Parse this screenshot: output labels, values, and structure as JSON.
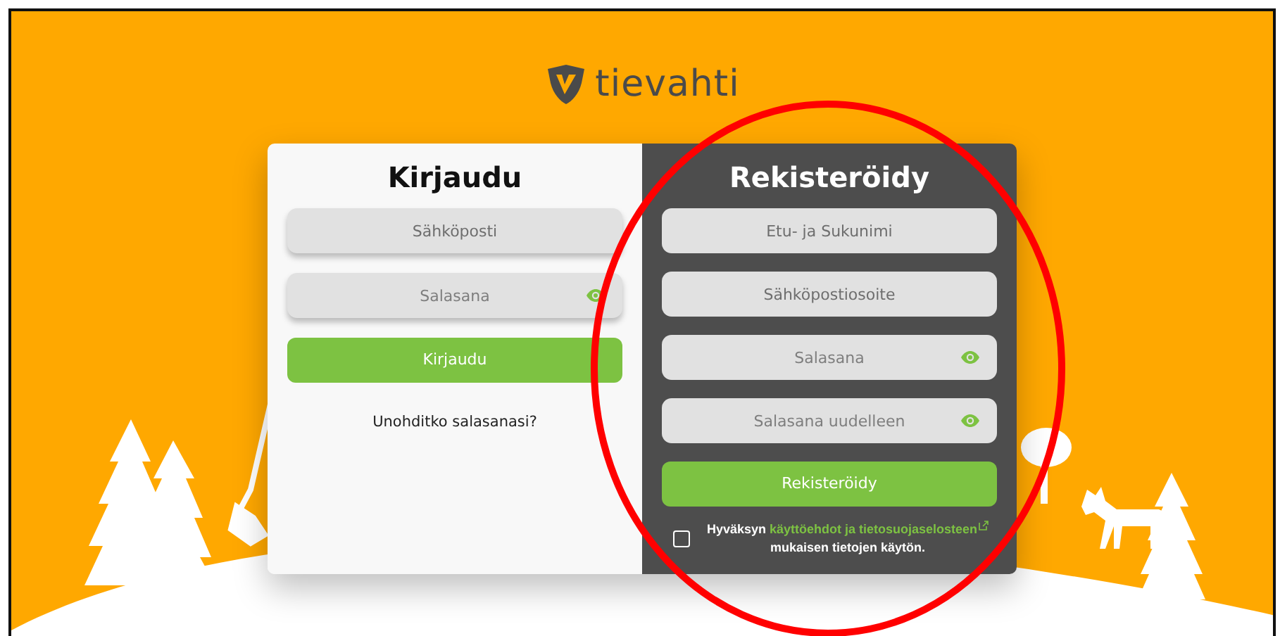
{
  "logo": {
    "text": "tievahti"
  },
  "login": {
    "title": "Kirjaudu",
    "fields": [
      {
        "placeholder": "Sähköposti",
        "kind": "text"
      },
      {
        "placeholder": "Salasana",
        "kind": "password"
      }
    ],
    "button": "Kirjaudu",
    "forgot_link": "Unohditko salasanasi?"
  },
  "register": {
    "title": "Rekisteröidy",
    "fields": [
      {
        "placeholder": "Etu- ja Sukunimi",
        "kind": "text"
      },
      {
        "placeholder": "Sähköpostiosoite",
        "kind": "text"
      },
      {
        "placeholder": "Salasana",
        "kind": "password"
      },
      {
        "placeholder": "Salasana uudelleen",
        "kind": "password"
      }
    ],
    "button": "Rekisteröidy",
    "consent": {
      "checked": false,
      "text_before": "Hyväksyn",
      "link": "käyttöehdot ja tietosuojaselosteen",
      "text_after": "mukaisen tietojen käytön."
    }
  }
}
